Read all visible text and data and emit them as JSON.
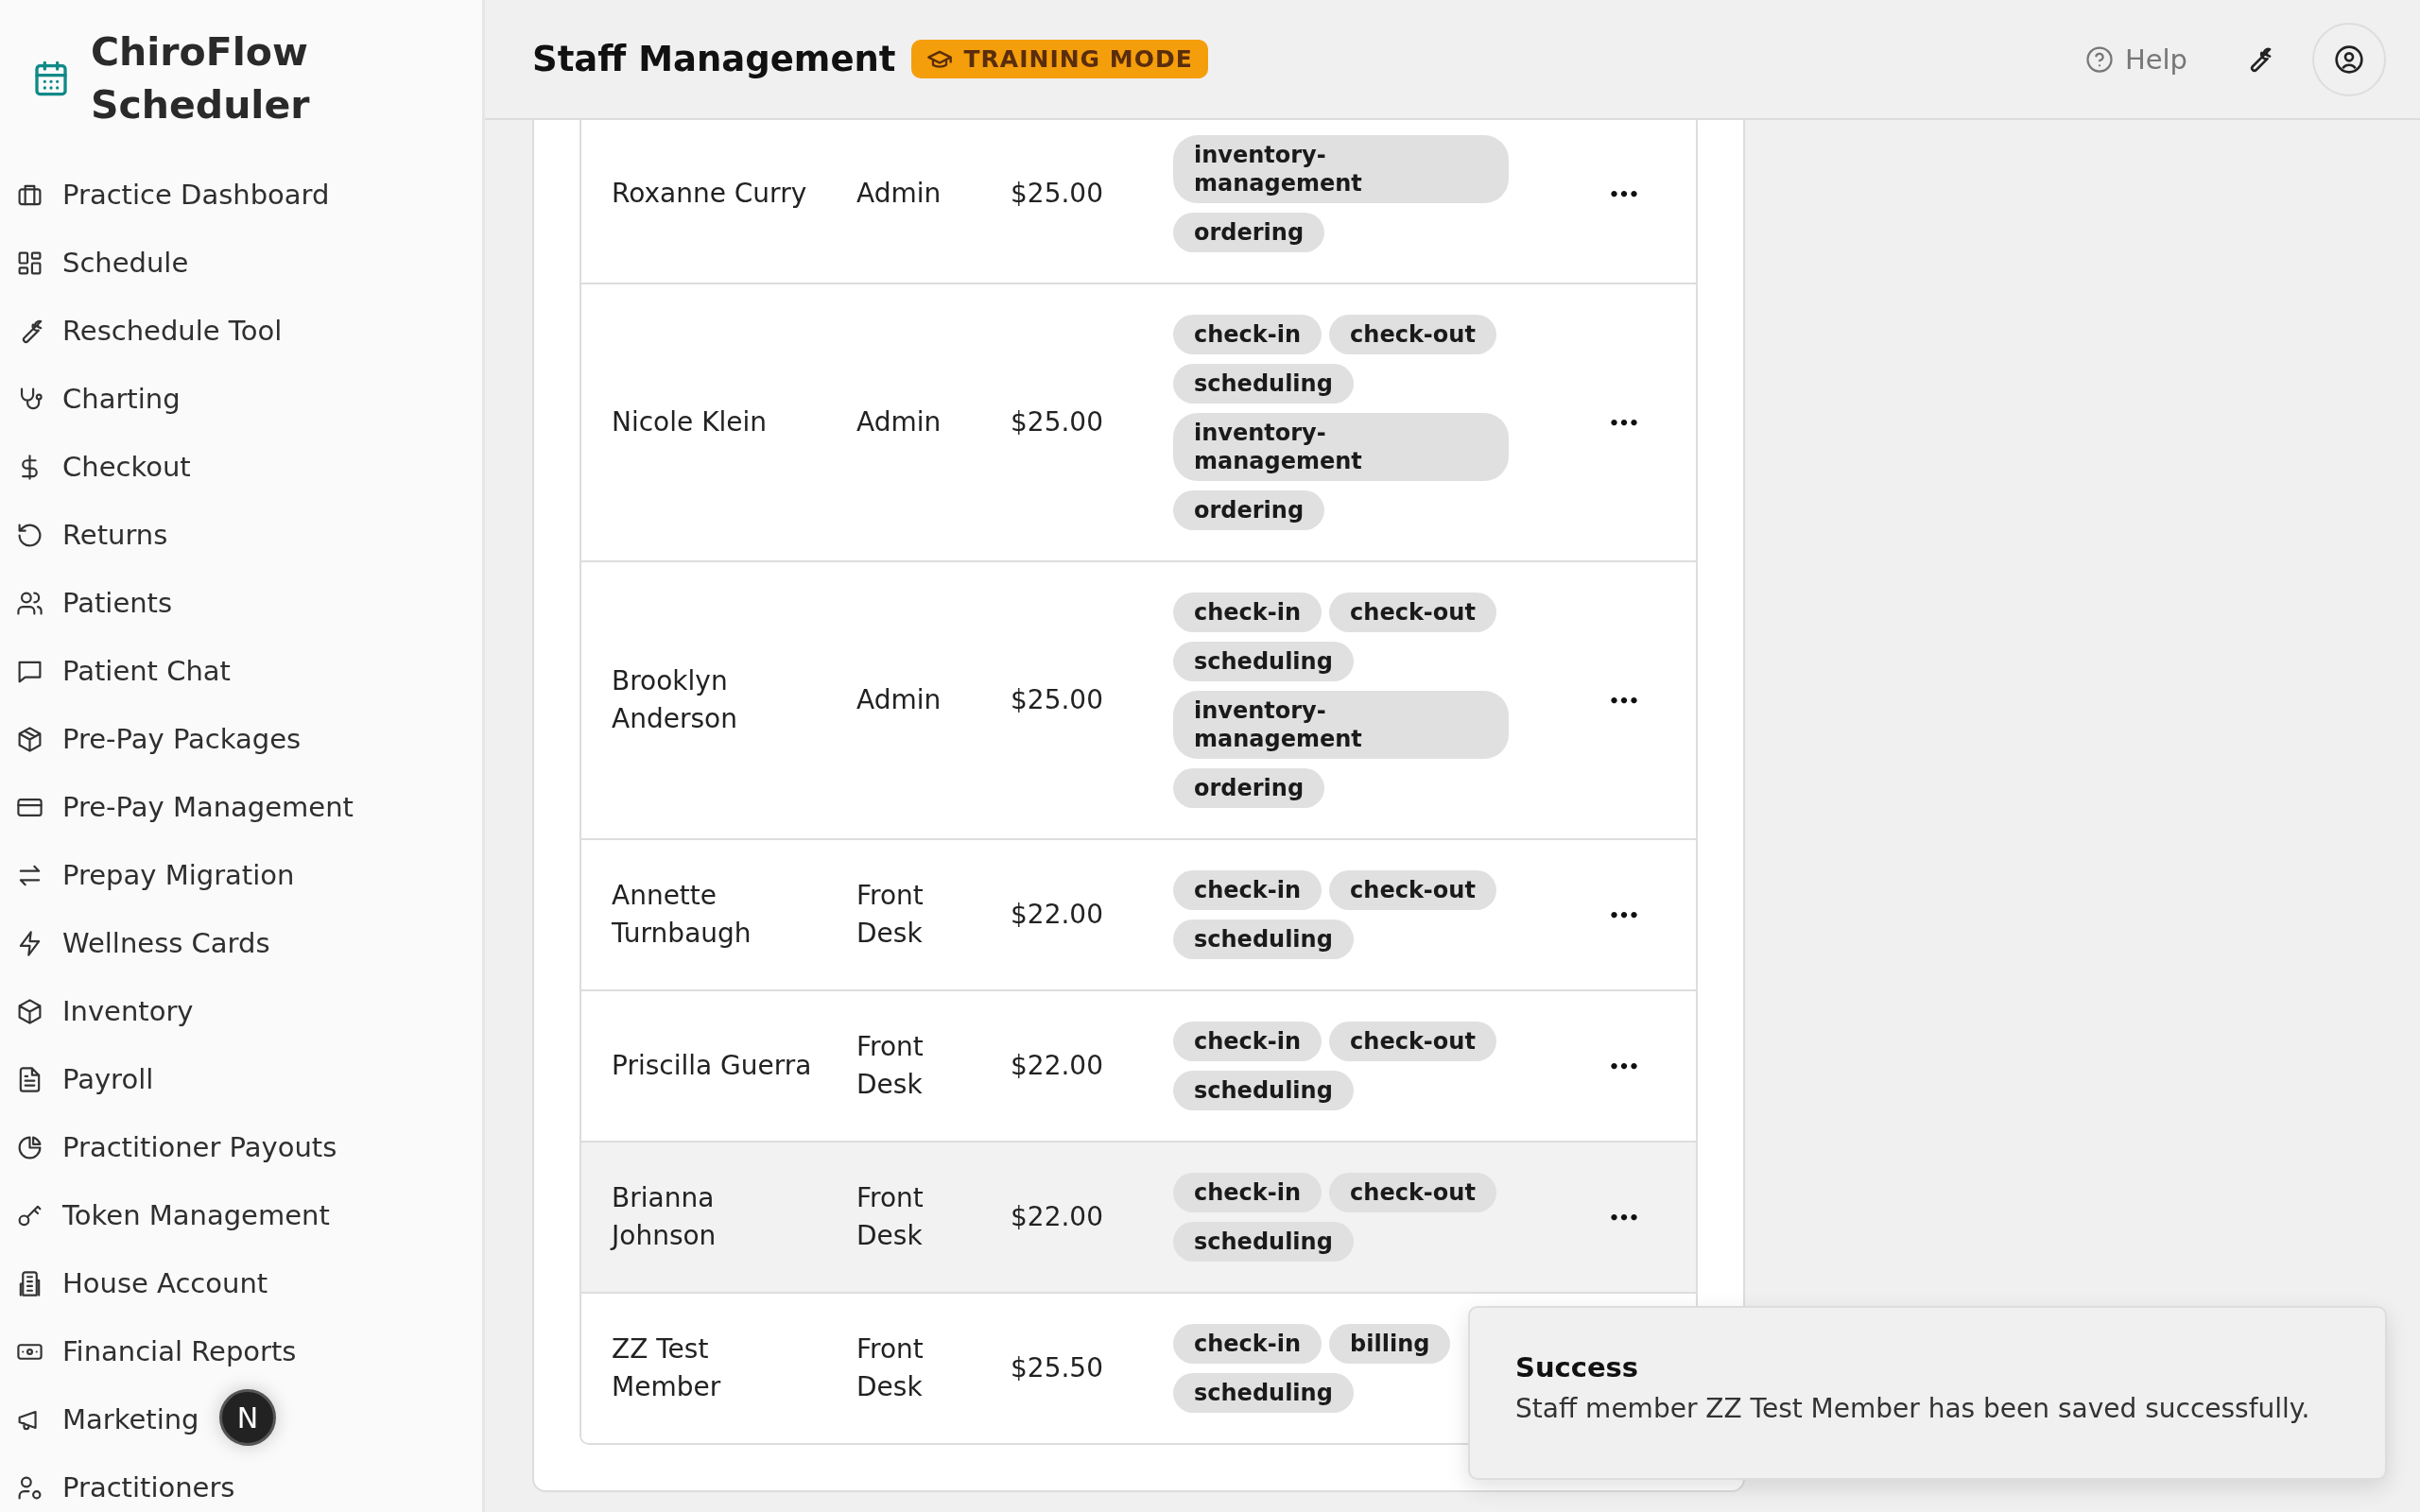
{
  "sidebar": {
    "brand": "ChiroFlow Scheduler",
    "items": [
      {
        "label": "Practice Dashboard"
      },
      {
        "label": "Schedule"
      },
      {
        "label": "Reschedule Tool"
      },
      {
        "label": "Charting"
      },
      {
        "label": "Checkout"
      },
      {
        "label": "Returns"
      },
      {
        "label": "Patients"
      },
      {
        "label": "Patient Chat"
      },
      {
        "label": "Pre-Pay Packages"
      },
      {
        "label": "Pre-Pay Management"
      },
      {
        "label": "Prepay Migration"
      },
      {
        "label": "Wellness Cards"
      },
      {
        "label": "Inventory"
      },
      {
        "label": "Payroll"
      },
      {
        "label": "Practitioner Payouts"
      },
      {
        "label": "Token Management"
      },
      {
        "label": "House Account"
      },
      {
        "label": "Financial Reports"
      },
      {
        "label": "Marketing"
      },
      {
        "label": "Practitioners"
      }
    ]
  },
  "header": {
    "title": "Staff Management",
    "badge": "TRAINING MODE",
    "help": "Help"
  },
  "staff_table": {
    "rows": [
      {
        "name": "Roxanne Curry",
        "role": "Admin",
        "rate": "$25.00",
        "permissions": [
          "inventory-management",
          "ordering"
        ],
        "actions": "•••",
        "hovered": false
      },
      {
        "name": "Nicole Klein",
        "role": "Admin",
        "rate": "$25.00",
        "permissions": [
          "check-in",
          "check-out",
          "scheduling",
          "inventory-management",
          "ordering"
        ],
        "actions": "•••",
        "hovered": false
      },
      {
        "name": "Brooklyn Anderson",
        "role": "Admin",
        "rate": "$25.00",
        "permissions": [
          "check-in",
          "check-out",
          "scheduling",
          "inventory-management",
          "ordering"
        ],
        "actions": "•••",
        "hovered": false
      },
      {
        "name": "Annette Turnbaugh",
        "role": "Front Desk",
        "rate": "$22.00",
        "permissions": [
          "check-in",
          "check-out",
          "scheduling"
        ],
        "actions": "•••",
        "hovered": false
      },
      {
        "name": "Priscilla Guerra",
        "role": "Front Desk",
        "rate": "$22.00",
        "permissions": [
          "check-in",
          "check-out",
          "scheduling"
        ],
        "actions": "•••",
        "hovered": false
      },
      {
        "name": "Brianna Johnson",
        "role": "Front Desk",
        "rate": "$22.00",
        "permissions": [
          "check-in",
          "check-out",
          "scheduling"
        ],
        "actions": "•••",
        "hovered": true
      },
      {
        "name": "ZZ Test Member",
        "role": "Front Desk",
        "rate": "$25.50",
        "permissions": [
          "check-in",
          "billing",
          "scheduling"
        ],
        "hovered": false
      }
    ]
  },
  "toast": {
    "title": "Success",
    "message": "Staff member ZZ Test Member has been saved successfully."
  },
  "dev_indicator": "N"
}
